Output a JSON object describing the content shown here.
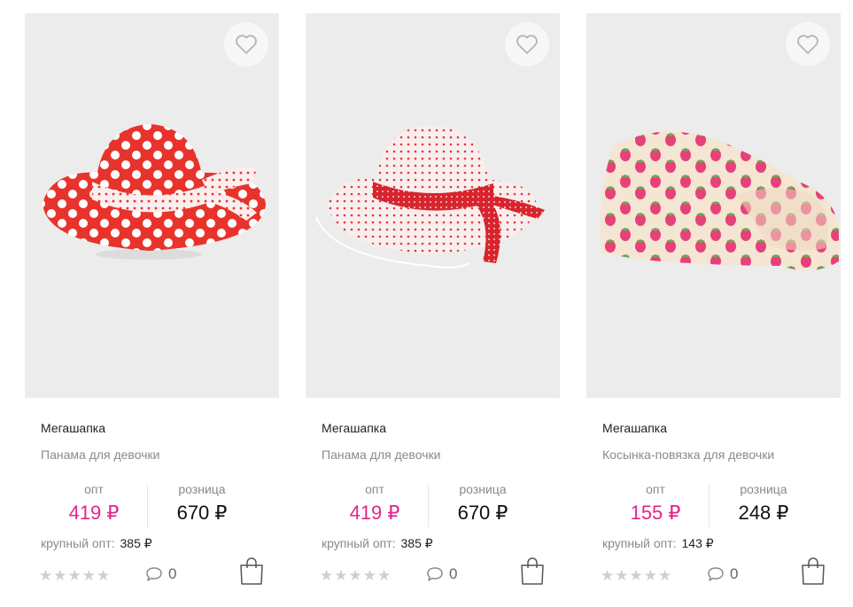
{
  "products": [
    {
      "brand": "Мегашапка",
      "name": "Панама для девочки",
      "opt_label": "опт",
      "opt_price": "419 ₽",
      "retail_label": "розница",
      "retail_price": "670 ₽",
      "bulk_label": "крупный опт:",
      "bulk_price": "385 ₽",
      "comments": "0",
      "rating": 0
    },
    {
      "brand": "Мегашапка",
      "name": "Панама для девочки",
      "opt_label": "опт",
      "opt_price": "419 ₽",
      "retail_label": "розница",
      "retail_price": "670 ₽",
      "bulk_label": "крупный опт:",
      "bulk_price": "385 ₽",
      "comments": "0",
      "rating": 0
    },
    {
      "brand": "Мегашапка",
      "name": "Косынка-повязка для девочки",
      "opt_label": "опт",
      "opt_price": "155 ₽",
      "retail_label": "розница",
      "retail_price": "248 ₽",
      "bulk_label": "крупный опт:",
      "bulk_price": "143 ₽",
      "comments": "0",
      "rating": 0
    }
  ],
  "icons": {
    "favorite": "heart-icon",
    "comments": "speech-bubble-icon",
    "cart": "shopping-bag-icon",
    "rating": "star-icon"
  },
  "colors": {
    "accent": "#e2268a",
    "photo_bg": "#ececec",
    "muted_text": "#8a8a8a",
    "star_empty": "#cfcfcf"
  }
}
